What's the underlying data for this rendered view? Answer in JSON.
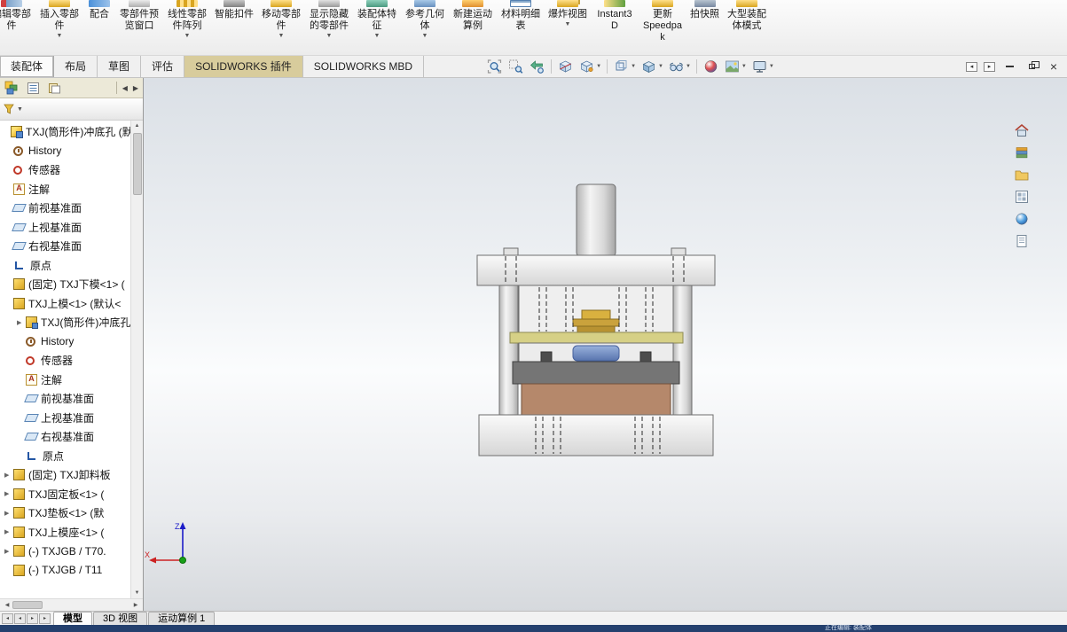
{
  "ui": {
    "caret_down": "▼",
    "tri_left": "◀",
    "tri_right": "▶",
    "tri_up": "▲",
    "tri_down": "▼",
    "small_left": "◂",
    "small_right": "▸",
    "close_glyph": "×"
  },
  "ribbon": {
    "items": [
      {
        "name": "ribbon-edit-component",
        "label": "编辑零部件",
        "icon": "edit-component",
        "dropdown": false
      },
      {
        "name": "ribbon-insert-components",
        "label": "插入零部件",
        "icon": "insert-component",
        "dropdown": true
      },
      {
        "name": "ribbon-mate",
        "label": "配合",
        "icon": "mate",
        "dropdown": false
      },
      {
        "name": "ribbon-component-preview-window",
        "label": "零部件预览窗口",
        "icon": "component-preview",
        "dropdown": false
      },
      {
        "name": "ribbon-linear-component-pattern",
        "label": "线性零部件阵列",
        "icon": "linear-pattern",
        "dropdown": true
      },
      {
        "name": "ribbon-smart-fasteners",
        "label": "智能扣件",
        "icon": "smart-fasteners",
        "dropdown": false
      },
      {
        "name": "ribbon-move-component",
        "label": "移动零部件",
        "icon": "move-component",
        "dropdown": true
      },
      {
        "name": "ribbon-show-hidden-components",
        "label": "显示隐藏的零部件",
        "icon": "show-hidden",
        "dropdown": true
      },
      {
        "name": "ribbon-assembly-features",
        "label": "装配体特征",
        "icon": "assembly-features",
        "dropdown": true
      },
      {
        "name": "ribbon-reference-geometry",
        "label": "参考几何体",
        "icon": "reference-geometry",
        "dropdown": true
      },
      {
        "name": "ribbon-new-motion-study",
        "label": "新建运动算例",
        "icon": "motion-study",
        "dropdown": false
      },
      {
        "name": "ribbon-bill-of-materials",
        "label": "材料明细表",
        "icon": "bom",
        "dropdown": false
      },
      {
        "name": "ribbon-exploded-view",
        "label": "爆炸视图",
        "icon": "exploded-view",
        "dropdown": true
      },
      {
        "name": "ribbon-instant3d",
        "label": "Instant3D",
        "icon": "instant3d",
        "dropdown": false
      },
      {
        "name": "ribbon-update-speedpak",
        "label": "更新Speedpak",
        "icon": "speedpak",
        "dropdown": false
      },
      {
        "name": "ribbon-take-snapshot",
        "label": "拍快照",
        "icon": "snapshot",
        "dropdown": false
      },
      {
        "name": "ribbon-large-assembly-mode",
        "label": "大型装配体模式",
        "icon": "large-assembly",
        "dropdown": false
      }
    ]
  },
  "command_tabs": [
    {
      "name": "tab-assembly",
      "label": "装配体",
      "state": "active"
    },
    {
      "name": "tab-layout",
      "label": "布局",
      "state": "normal"
    },
    {
      "name": "tab-sketch",
      "label": "草图",
      "state": "normal"
    },
    {
      "name": "tab-evaluate",
      "label": "评估",
      "state": "normal"
    },
    {
      "name": "tab-solidworks-addins",
      "label": "SOLIDWORKS 插件",
      "state": "tan"
    },
    {
      "name": "tab-solidworks-mbd",
      "label": "SOLIDWORKS MBD",
      "state": "normal"
    }
  ],
  "headsup": {
    "icons": [
      "zoom-to-fit",
      "zoom-to-area",
      "previous-view",
      "section-view",
      "annotation-views",
      "view-orientation",
      "display-style",
      "hide-show-items",
      "edit-appearance",
      "apply-scene",
      "view-settings"
    ]
  },
  "feature_tree": {
    "rows": [
      {
        "name": "tree-root-assembly",
        "depth": 0,
        "icon": "assembly",
        "label": "TXJ(筒形件)冲底孔 (默认<"
      },
      {
        "name": "tree-history",
        "depth": 1,
        "icon": "history",
        "label": "History"
      },
      {
        "name": "tree-sensors",
        "depth": 1,
        "icon": "sensor",
        "label": "传感器"
      },
      {
        "name": "tree-annotations",
        "depth": 1,
        "icon": "annotation",
        "label": "注解"
      },
      {
        "name": "tree-front-plane",
        "depth": 1,
        "icon": "plane",
        "label": "前视基准面"
      },
      {
        "name": "tree-top-plane",
        "depth": 1,
        "icon": "plane",
        "label": "上视基准面"
      },
      {
        "name": "tree-right-plane",
        "depth": 1,
        "icon": "plane",
        "label": "右视基准面"
      },
      {
        "name": "tree-origin",
        "depth": 1,
        "icon": "origin",
        "label": "原点"
      },
      {
        "name": "tree-txj-lower-die",
        "depth": 1,
        "icon": "part",
        "label": "(固定) TXJ下模<1> ("
      },
      {
        "name": "tree-txj-upper-die",
        "depth": 1,
        "icon": "part",
        "label": "TXJ上模<1> (默认<"
      },
      {
        "name": "tree-sub-assembly-doc",
        "depth": 2,
        "icon": "part2",
        "label": "TXJ(筒形件)冲底孔",
        "arrow": "▶"
      },
      {
        "name": "tree-history-2",
        "depth": 2,
        "icon": "history",
        "label": "History"
      },
      {
        "name": "tree-sensors-2",
        "depth": 2,
        "icon": "sensor",
        "label": "传感器"
      },
      {
        "name": "tree-annotations-2",
        "depth": 2,
        "icon": "annotation",
        "label": "注解"
      },
      {
        "name": "tree-front-plane-2",
        "depth": 2,
        "icon": "plane",
        "label": "前视基准面"
      },
      {
        "name": "tree-top-plane-2",
        "depth": 2,
        "icon": "plane",
        "label": "上视基准面"
      },
      {
        "name": "tree-right-plane-2",
        "depth": 2,
        "icon": "plane",
        "label": "右视基准面"
      },
      {
        "name": "tree-origin-2",
        "depth": 2,
        "icon": "origin",
        "label": "原点"
      },
      {
        "name": "tree-txj-stripper-plate",
        "depth": 1,
        "icon": "part",
        "label": "(固定) TXJ卸料板",
        "arrow": "▶"
      },
      {
        "name": "tree-txj-fixing-plate",
        "depth": 1,
        "icon": "part",
        "label": "TXJ固定板<1> (",
        "arrow": "▶"
      },
      {
        "name": "tree-txj-backing-plate",
        "depth": 1,
        "icon": "part",
        "label": "TXJ垫板<1> (默",
        "arrow": "▶"
      },
      {
        "name": "tree-txj-upper-die-holder",
        "depth": 1,
        "icon": "part",
        "label": "TXJ上模座<1> (",
        "arrow": "▶"
      },
      {
        "name": "tree-txjgb-t70",
        "depth": 1,
        "icon": "part",
        "label": "(-) TXJGB / T70.",
        "arrow": "▶"
      },
      {
        "name": "tree-txjgb-t11",
        "depth": 1,
        "icon": "part",
        "label": "(-) TXJGB / T11"
      }
    ]
  },
  "taskpane": {
    "icons": [
      "solidworks-resources",
      "design-library",
      "file-explorer",
      "view-palette",
      "appearances-scenes",
      "custom-properties"
    ]
  },
  "viewport": {
    "triad": {
      "x_label": "X",
      "z_label": "Z"
    }
  },
  "model": {
    "part_colors": {
      "shank": "#d8d8d8",
      "upper_plate": "#f2f2f2",
      "stripper_plate": "#d6d086",
      "punch": "#caa23c",
      "disc": "#7a90c4",
      "die_plate": "#757575",
      "lower_block": "#b5886b",
      "base_plate": "#f0f0f0"
    }
  },
  "bottom_tabs": [
    {
      "name": "bottom-tab-model",
      "label": "模型",
      "state": "active"
    },
    {
      "name": "bottom-tab-3d-views",
      "label": "3D 视图",
      "state": "normal"
    },
    {
      "name": "bottom-tab-motion-study-1",
      "label": "运动算例 1",
      "state": "normal"
    }
  ],
  "status_bar": {
    "text": "正在编辑: 装配体"
  }
}
